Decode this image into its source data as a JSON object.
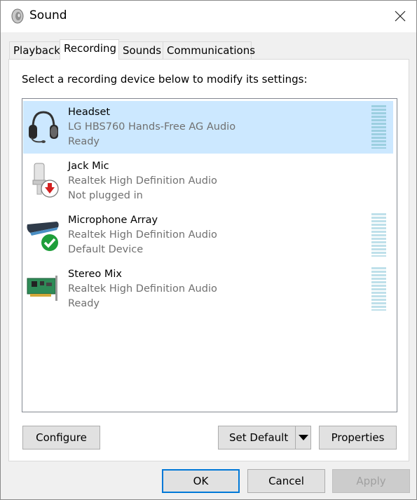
{
  "window": {
    "title": "Sound"
  },
  "tabs": [
    {
      "label": "Playback",
      "active": false
    },
    {
      "label": "Recording",
      "active": true
    },
    {
      "label": "Sounds",
      "active": false
    },
    {
      "label": "Communications",
      "active": false
    }
  ],
  "instruction": "Select a recording device below to modify its settings:",
  "devices": [
    {
      "name": "Headset",
      "driver": "LG HBS760 Hands-Free AG Audio",
      "status": "Ready",
      "icon": "headset-icon",
      "selected": true,
      "meter": true
    },
    {
      "name": "Jack Mic",
      "driver": "Realtek High Definition Audio",
      "status": "Not plugged in",
      "icon": "microphone-unplugged-icon",
      "selected": false,
      "meter": false
    },
    {
      "name": "Microphone Array",
      "driver": "Realtek High Definition Audio",
      "status": "Default Device",
      "icon": "microphone-array-default-icon",
      "selected": false,
      "meter": true
    },
    {
      "name": "Stereo Mix",
      "driver": "Realtek High Definition Audio",
      "status": "Ready",
      "icon": "sound-card-icon",
      "selected": false,
      "meter": true
    }
  ],
  "buttons": {
    "configure": "Configure",
    "set_default": "Set Default",
    "properties": "Properties",
    "ok": "OK",
    "cancel": "Cancel",
    "apply": "Apply"
  },
  "colors": {
    "selection": "#cce8ff",
    "accent": "#0078d7",
    "secondary_text": "#707070"
  }
}
